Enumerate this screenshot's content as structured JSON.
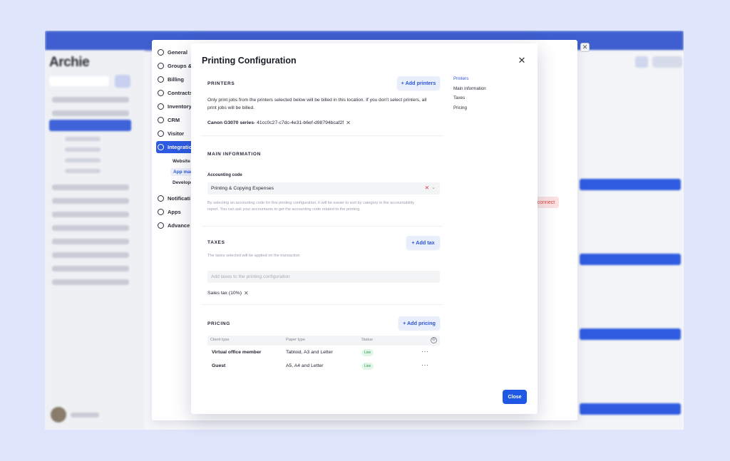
{
  "background_app": {
    "brand": "Archie",
    "side_nav": [
      {
        "label": "General",
        "icon": "gear-icon"
      },
      {
        "label": "Groups &",
        "icon": "lock-icon"
      },
      {
        "label": "Billing",
        "icon": "billing-icon"
      },
      {
        "label": "Contracts",
        "icon": "contract-icon"
      },
      {
        "label": "Inventory",
        "icon": "inventory-icon"
      },
      {
        "label": "CRM",
        "icon": "anchor-icon"
      },
      {
        "label": "Visitor",
        "icon": "person-icon"
      },
      {
        "label": "Integrations",
        "icon": "cloud-icon"
      }
    ],
    "side_nav_subs": [
      "Website",
      "App mark",
      "Develope"
    ],
    "side_nav_after": [
      {
        "label": "Notificati",
        "icon": "mail-icon"
      },
      {
        "label": "Apps",
        "icon": "apps-icon"
      },
      {
        "label": "Advance",
        "icon": "advance-icon"
      }
    ],
    "red_chip": "connect"
  },
  "modal": {
    "title": "Printing Configuration",
    "printers": {
      "heading": "PRINTERS",
      "add_label": "+ Add printers",
      "description_line1": "Only print jobs from the printers selected below will be billed in this location. If you don't select printers, all",
      "description_line2": "print jobs will be billed.",
      "printer_name": "Canon G3070 series",
      "printer_id": " - 41cc0c27-c7dc-4e31-b6ef-d98794bcaf2f"
    },
    "main_info": {
      "heading": "MAIN INFORMATION",
      "accounting_label": "Accounting code",
      "accounting_value": "Printing & Copying Expenses",
      "help_line1": "By selecting an accounting code for this printing configuration, it will be easier to sort by category in the accountability",
      "help_line2": "report. You can ask your accountants to get the accounting code related to the printing."
    },
    "taxes": {
      "heading": "TAXES",
      "add_label": "+ Add tax",
      "note": "The taxes selected will be applied on the transaction",
      "placeholder": "Add taxes to the printing configuration",
      "tag": "Sales tax (10%)"
    },
    "pricing": {
      "heading": "PRICING",
      "add_label": "+ Add pricing",
      "columns": [
        "Client type",
        "Paper type",
        "Status"
      ],
      "rows": [
        {
          "client": "Virtual office member",
          "paper": "Tabloid, A3 and Letter",
          "status": "Live"
        },
        {
          "client": "Guest",
          "paper": "A5, A4 and Letter",
          "status": "Live"
        }
      ]
    },
    "toc": [
      "Printers",
      "Main information",
      "Taxes",
      "Pricing"
    ],
    "close_label": "Close"
  },
  "colors": {
    "primary": "#1f58e5",
    "accent_soft": "#e9eefc",
    "live_badge": "#e2f6e7"
  }
}
